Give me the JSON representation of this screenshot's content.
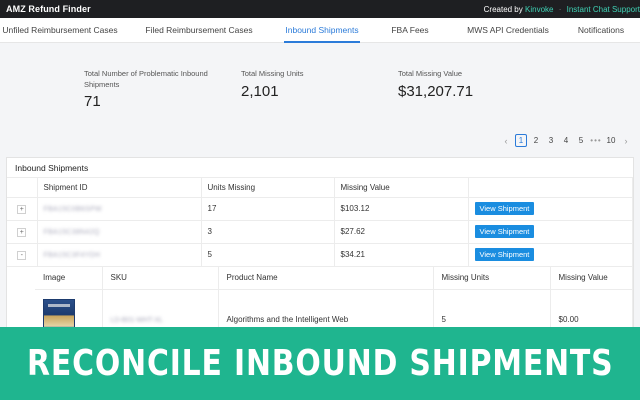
{
  "app": {
    "title": "AMZ Refund Finder",
    "created_by_prefix": "Created by",
    "created_by_name": "Kinvoke",
    "separator": "·",
    "support_label": "Instant Chat Support"
  },
  "tabs": [
    {
      "label": "Unfiled Reimbursement Cases",
      "active": false
    },
    {
      "label": "Filed Reimbursement Cases",
      "active": false
    },
    {
      "label": "Inbound Shipments",
      "active": true
    },
    {
      "label": "FBA Fees",
      "active": false
    },
    {
      "label": "MWS API Credentials",
      "active": false
    },
    {
      "label": "Notifications",
      "active": false
    }
  ],
  "stats": [
    {
      "label": "Total Number of Problematic Inbound Shipments",
      "value": "71"
    },
    {
      "label": "Total Missing Units",
      "value": "2,101"
    },
    {
      "label": "Total Missing Value",
      "value": "$31,207.71"
    }
  ],
  "pagination": {
    "prev": "‹",
    "next": "›",
    "pages": [
      "1",
      "2",
      "3",
      "4",
      "5"
    ],
    "current": "1",
    "ellipsis": "•••",
    "last": "10"
  },
  "panel": {
    "title": "Inbound Shipments",
    "columns": [
      "Shipment ID",
      "Units Missing",
      "Missing Value"
    ],
    "rows": [
      {
        "expander": "+",
        "shipment_id": "FBA15C0B6SPW",
        "units": "17",
        "value": "$103.12",
        "action": "View Shipment"
      },
      {
        "expander": "+",
        "shipment_id": "FBA15C38N42Q",
        "units": "3",
        "value": "$27.62",
        "action": "View Shipment"
      },
      {
        "expander": "-",
        "shipment_id": "FBA15C3F4YDH",
        "units": "5",
        "value": "$34.21",
        "action": "View Shipment"
      }
    ],
    "detail": {
      "columns": [
        "Image",
        "SKU",
        "Product Name",
        "Missing Units",
        "Missing Value"
      ],
      "rows": [
        {
          "sku": "LD-B01-WHT-XL",
          "product_name": "Algorithms and the Intelligent Web",
          "missing_units": "5",
          "missing_value": "$0.00"
        }
      ]
    }
  },
  "banner": {
    "text": "RECONCILE INBOUND SHIPMENTS",
    "color": "#1fb58f"
  }
}
